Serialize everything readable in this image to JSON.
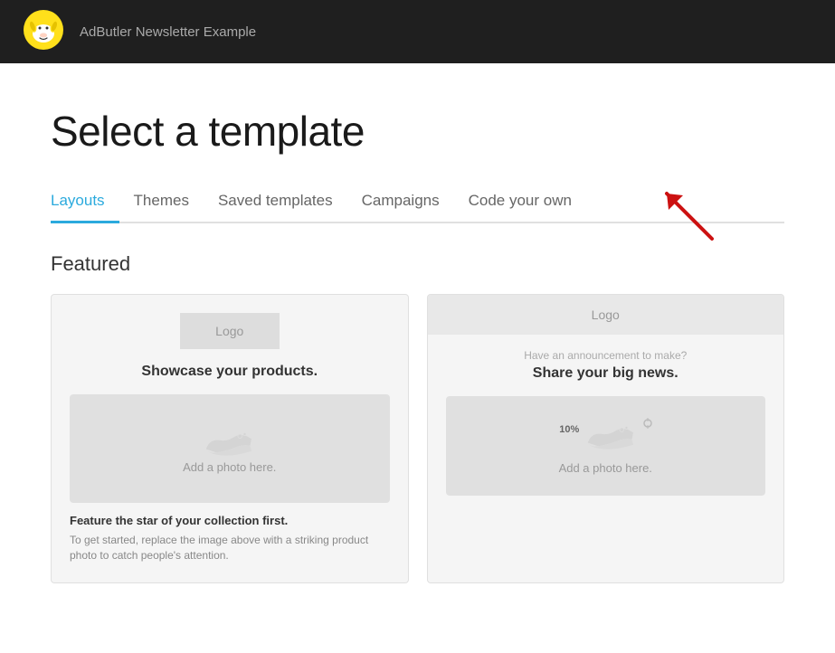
{
  "header": {
    "title": "AdButler Newsletter Example",
    "logo_alt": "Mailchimp logo"
  },
  "page": {
    "title": "Select a template"
  },
  "tabs": {
    "items": [
      {
        "id": "layouts",
        "label": "Layouts",
        "active": true
      },
      {
        "id": "themes",
        "label": "Themes",
        "active": false
      },
      {
        "id": "saved-templates",
        "label": "Saved templates",
        "active": false
      },
      {
        "id": "campaigns",
        "label": "Campaigns",
        "active": false
      },
      {
        "id": "code-your-own",
        "label": "Code your own",
        "active": false
      }
    ]
  },
  "featured": {
    "section_title": "Featured",
    "cards": [
      {
        "logo_label": "Logo",
        "headline": "Showcase your products.",
        "image_label": "Add a photo here.",
        "subtext": "Feature the star of your collection first.",
        "body_text": "To get started, replace the image above with a striking product photo to catch people's attention."
      },
      {
        "logo_label": "Logo",
        "promo_text": "Have an announcement to make?",
        "headline": "Share your big news.",
        "image_label": "Add a photo here.",
        "badge_text": "10%"
      }
    ]
  },
  "arrow": {
    "color": "#cc1111",
    "target_tab": "code-your-own"
  }
}
